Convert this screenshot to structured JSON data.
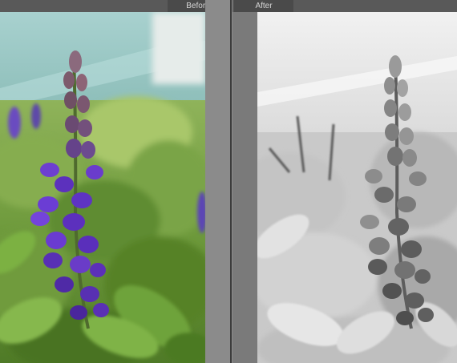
{
  "view": {
    "before_label": "Before",
    "after_label": "After"
  },
  "photo": {
    "before_mode": "color",
    "after_mode": "black-and-white"
  }
}
